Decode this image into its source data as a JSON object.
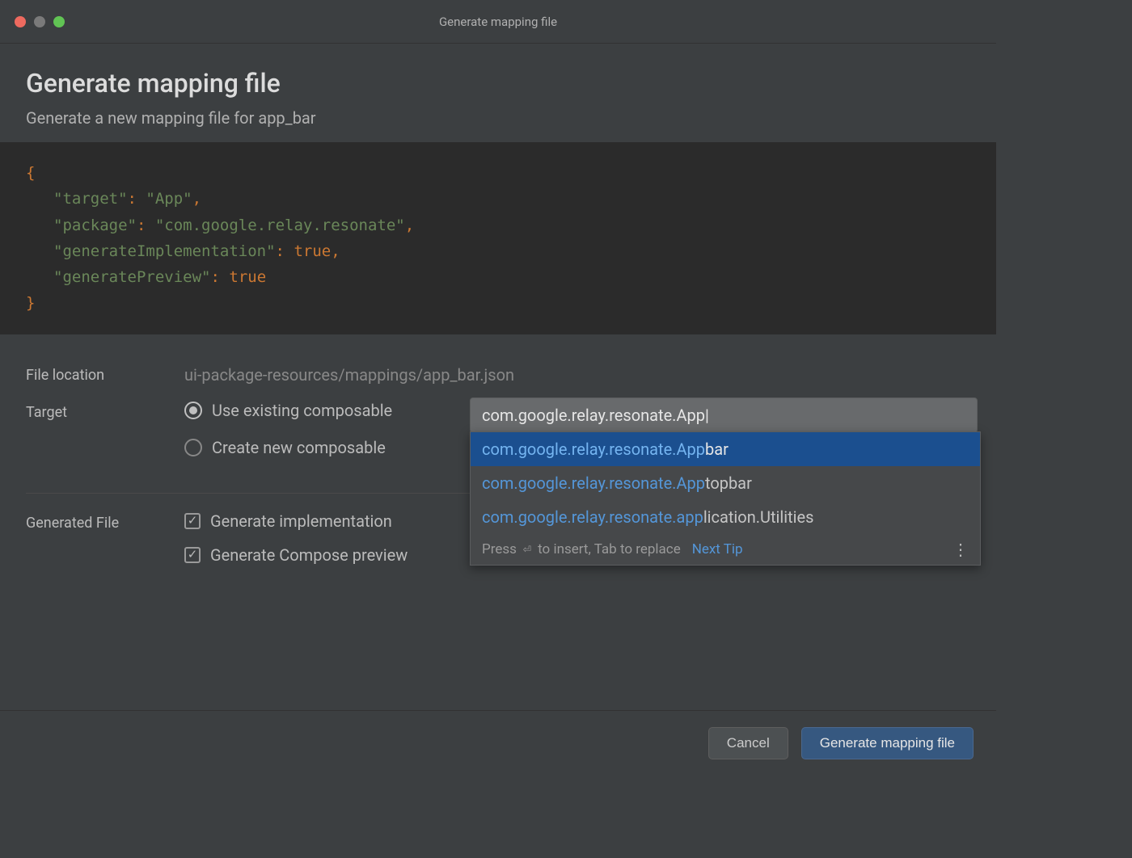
{
  "titlebar": "Generate mapping file",
  "header": {
    "title": "Generate mapping file",
    "subtitle": "Generate a new mapping file for app_bar"
  },
  "code": {
    "target_key": "\"target\"",
    "target_val": "\"App\"",
    "package_key": "\"package\"",
    "package_val": "\"com.google.relay.resonate\"",
    "gen_impl_key": "\"generateImplementation\"",
    "gen_impl_val": "true",
    "gen_prev_key": "\"generatePreview\"",
    "gen_prev_val": "true"
  },
  "form": {
    "file_location_label": "File location",
    "file_location_value": "ui-package-resources/mappings/app_bar.json",
    "target_label": "Target",
    "radio_existing": "Use existing composable",
    "radio_new": "Create new composable",
    "input_value": "com.google.relay.resonate.App|",
    "generated_file_label": "Generated File",
    "checkbox_impl": "Generate implementation",
    "checkbox_preview": "Generate Compose preview"
  },
  "autocomplete": {
    "items": [
      {
        "match": "com.google.relay.resonate.App",
        "rest": "bar",
        "selected": true
      },
      {
        "match": "com.google.relay.resonate.App",
        "rest": "topbar",
        "selected": false
      },
      {
        "match": "com.google.relay.resonate.app",
        "rest": "lication.Utilities",
        "selected": false
      }
    ],
    "hint_prefix": "Press ",
    "hint_suffix": " to insert, Tab to replace",
    "next_tip": "Next Tip"
  },
  "footer": {
    "cancel": "Cancel",
    "generate": "Generate mapping file"
  }
}
